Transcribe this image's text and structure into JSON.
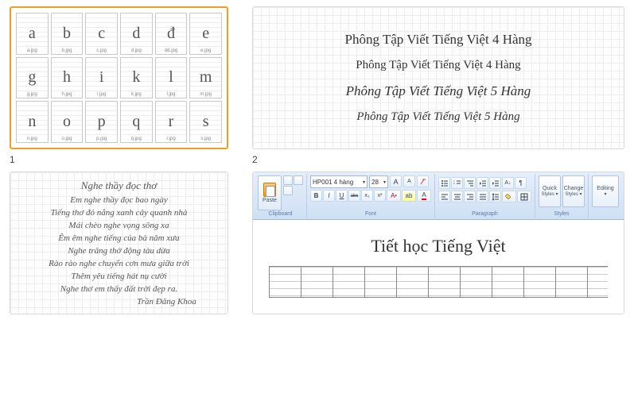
{
  "thumbs": {
    "labels": [
      "1",
      "2"
    ],
    "t1": {
      "letters": [
        "a",
        "b",
        "c",
        "d",
        "đ",
        "e",
        "g",
        "h",
        "i",
        "k",
        "l",
        "m",
        "n",
        "o",
        "p",
        "q",
        "r",
        "s"
      ],
      "captions": [
        "a.jpg",
        "b.jpg",
        "c.jpg",
        "d.jpg",
        "dd.jpg",
        "e.jpg",
        "g.jpg",
        "h.jpg",
        "i.jpg",
        "k.jpg",
        "l.jpg",
        "m.jpg",
        "n.jpg",
        "o.jpg",
        "p.jpg",
        "q.jpg",
        "r.jpg",
        "s.jpg"
      ]
    },
    "t2": {
      "lines": [
        "Phông Tập Viết Tiếng Việt 4 Hàng",
        "Phông Tập Viết Tiếng Việt 4 Hàng",
        "Phông Tập Viết Tiếng Việt 5 Hàng",
        "Phông Tập Viết Tiếng Việt 5 Hàng"
      ]
    },
    "t3": {
      "poem": [
        "Nghe thầy đọc thơ",
        "Em nghe thầy đọc bao ngày",
        "Tiếng thơ đỏ nắng xanh cây quanh nhà",
        "Mái chèo nghe vọng sông xa",
        "Êm êm nghe tiếng của bà năm xưa",
        "Nghe trăng thở động tàu dừa",
        "Rào rào nghe chuyển cơn mưa giữa trời",
        "Thêm yêu tiếng hát nụ cười",
        "Nghe thơ em thấy đất trời đẹp ra.",
        "Trần Đăng Khoa"
      ]
    },
    "t4": {
      "ribbon": {
        "paste": "Paste",
        "font_name": "HP001 4 hàng",
        "font_size": "28",
        "groups": {
          "clipboard": "Clipboard",
          "font": "Font",
          "paragraph": "Paragraph",
          "styles": "Styles",
          "editing": "Editing"
        },
        "btns": {
          "bold": "B",
          "italic": "I",
          "underline": "U",
          "strike": "abc",
          "sub": "x₂",
          "sup": "x²"
        },
        "quick": "Quick",
        "change": "Change",
        "qsub": "Styles ▾",
        "csub": "Styles ▾",
        "editing": "Editing",
        "editsub": "▾"
      },
      "doc_title": "Tiết học Tiếng Việt"
    }
  }
}
